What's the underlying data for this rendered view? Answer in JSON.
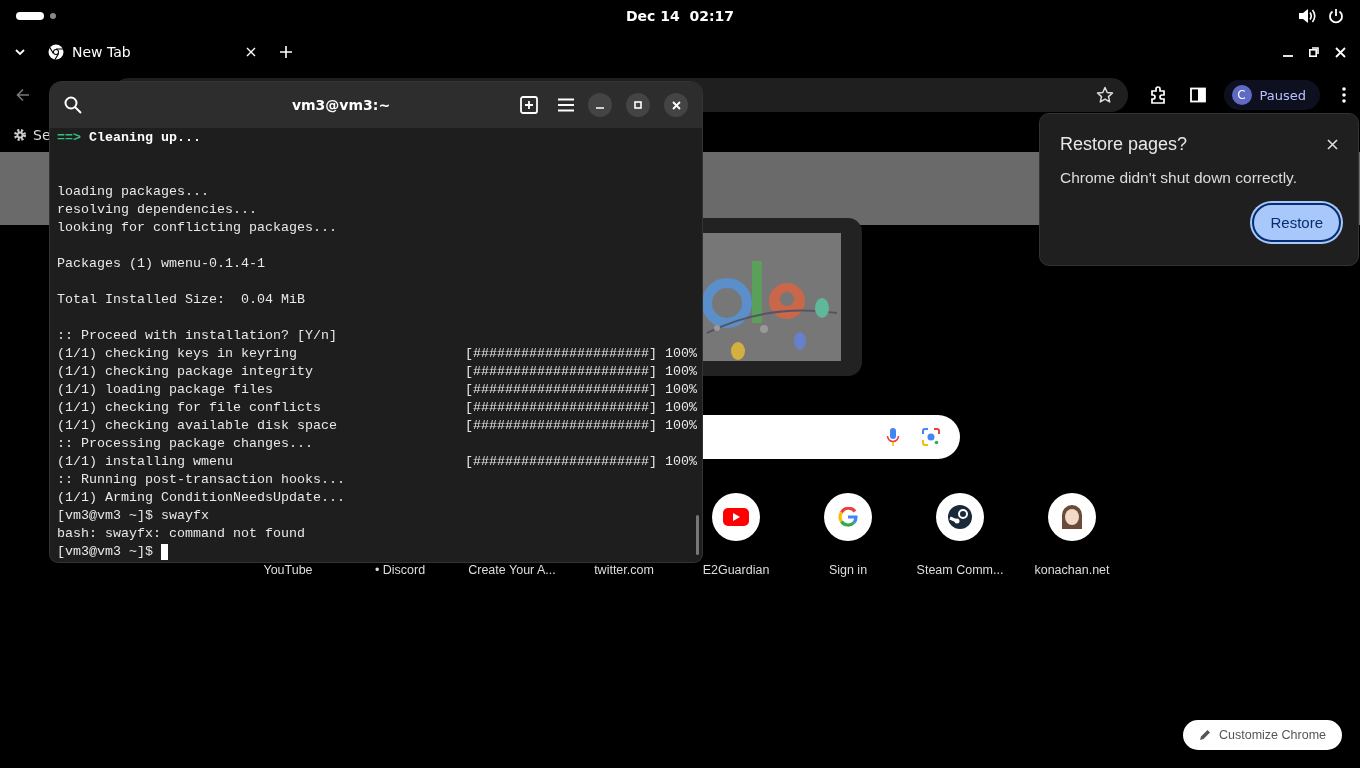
{
  "top_bar": {
    "clock": "Dec 14  02:17"
  },
  "tabs": [
    {
      "title": "New Tab",
      "selected": true
    }
  ],
  "toolbar": {
    "profile": {
      "initial": "C",
      "status": "Paused"
    }
  },
  "bookmarks_bar": {
    "items": [
      {
        "label": "Se"
      }
    ]
  },
  "new_tab_page": {
    "shortcuts": [
      {
        "label": "YouTube",
        "kind": "label"
      },
      {
        "label": "• Discord",
        "kind": "label"
      },
      {
        "label": "Create Your A...",
        "kind": "label"
      },
      {
        "label": "twitter.com",
        "kind": "label"
      },
      {
        "label": "E2Guardian",
        "kind": "tile"
      },
      {
        "label": "Sign in",
        "kind": "tile"
      },
      {
        "label": "Steam Comm...",
        "kind": "tile"
      },
      {
        "label": "konachan.net",
        "kind": "tile"
      }
    ],
    "customize_button": "Customize Chrome"
  },
  "restore_bubble": {
    "title": "Restore pages?",
    "message": "Chrome didn't shut down correctly.",
    "button": "Restore"
  },
  "terminal": {
    "title": "vm3@vm3:~",
    "lines": [
      {
        "kind": "heading",
        "prefix": "==>",
        "text": "Cleaning up..."
      },
      {
        "kind": "blank"
      },
      {
        "kind": "blank"
      },
      {
        "kind": "text",
        "text": "loading packages..."
      },
      {
        "kind": "text",
        "text": "resolving dependencies..."
      },
      {
        "kind": "text",
        "text": "looking for conflicting packages..."
      },
      {
        "kind": "blank"
      },
      {
        "kind": "text",
        "text": "Packages (1) wmenu-0.1.4-1"
      },
      {
        "kind": "blank"
      },
      {
        "kind": "text",
        "text": "Total Installed Size:  0.04 MiB"
      },
      {
        "kind": "blank"
      },
      {
        "kind": "text",
        "text": ":: Proceed with installation? [Y/n]"
      },
      {
        "kind": "progress",
        "text": "(1/1) checking keys in keyring",
        "bar": "[######################]",
        "percent": "100%"
      },
      {
        "kind": "progress",
        "text": "(1/1) checking package integrity",
        "bar": "[######################]",
        "percent": "100%"
      },
      {
        "kind": "progress",
        "text": "(1/1) loading package files",
        "bar": "[######################]",
        "percent": "100%"
      },
      {
        "kind": "progress",
        "text": "(1/1) checking for file conflicts",
        "bar": "[######################]",
        "percent": "100%"
      },
      {
        "kind": "progress",
        "text": "(1/1) checking available disk space",
        "bar": "[######################]",
        "percent": "100%"
      },
      {
        "kind": "text",
        "text": ":: Processing package changes..."
      },
      {
        "kind": "progress",
        "text": "(1/1) installing wmenu",
        "bar": "[######################]",
        "percent": "100%"
      },
      {
        "kind": "text",
        "text": ":: Running post-transaction hooks..."
      },
      {
        "kind": "text",
        "text": "(1/1) Arming ConditionNeedsUpdate..."
      },
      {
        "kind": "text",
        "text": "[vm3@vm3 ~]$ swayfx"
      },
      {
        "kind": "text",
        "text": "bash: swayfx: command not found"
      },
      {
        "kind": "prompt",
        "text": "[vm3@vm3 ~]$",
        "cursor": true
      }
    ]
  }
}
